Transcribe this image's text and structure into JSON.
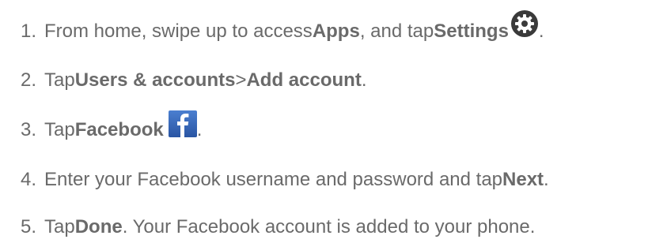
{
  "steps": [
    {
      "num": "1.",
      "parts": [
        "From home, swipe up to access ",
        "Apps",
        ", and tap ",
        "Settings",
        "."
      ]
    },
    {
      "num": "2.",
      "parts": [
        "Tap ",
        "Users & accounts",
        " > ",
        "Add account",
        "."
      ]
    },
    {
      "num": "3.",
      "parts": [
        "Tap ",
        "Facebook",
        "."
      ]
    },
    {
      "num": "4.",
      "parts": [
        "Enter your Facebook username and password and tap ",
        "Next",
        "."
      ]
    },
    {
      "num": "5.",
      "parts": [
        "Tap ",
        "Done",
        ". Your Facebook account is added to your phone."
      ]
    }
  ],
  "icons": {
    "settings": "settings-gear-icon",
    "facebook": "facebook-icon"
  },
  "colors": {
    "text": "#6a6a6a",
    "gear_bg": "#3a3a3a",
    "facebook_bg": "#2f5fb3"
  }
}
